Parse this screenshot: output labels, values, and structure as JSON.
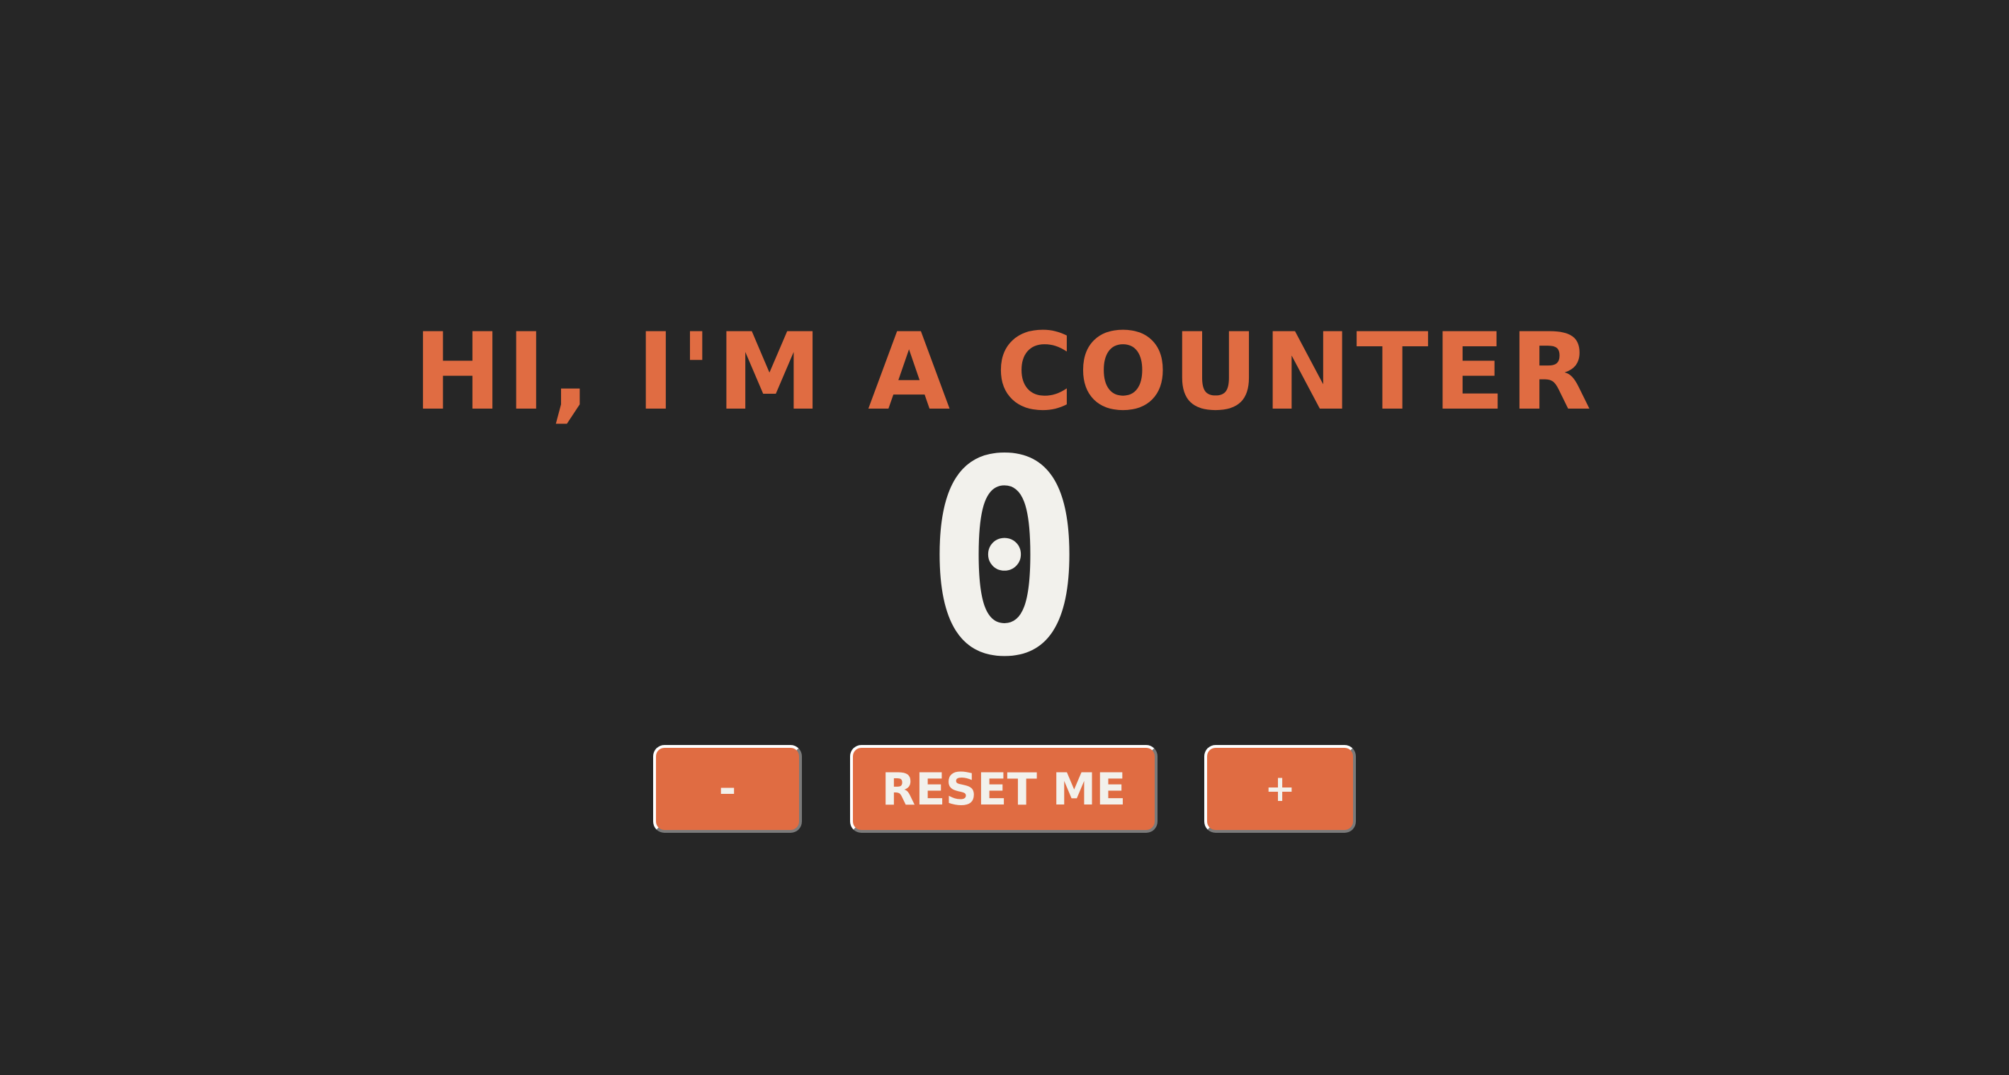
{
  "app": {
    "title": "HI, I'M A COUNTER",
    "count": "0"
  },
  "controls": {
    "decrement_label": "-",
    "reset_label": "RESET ME",
    "increment_label": "+"
  },
  "colors": {
    "background": "#262626",
    "accent": "#e06c42",
    "text_light": "#f2f1ec"
  }
}
